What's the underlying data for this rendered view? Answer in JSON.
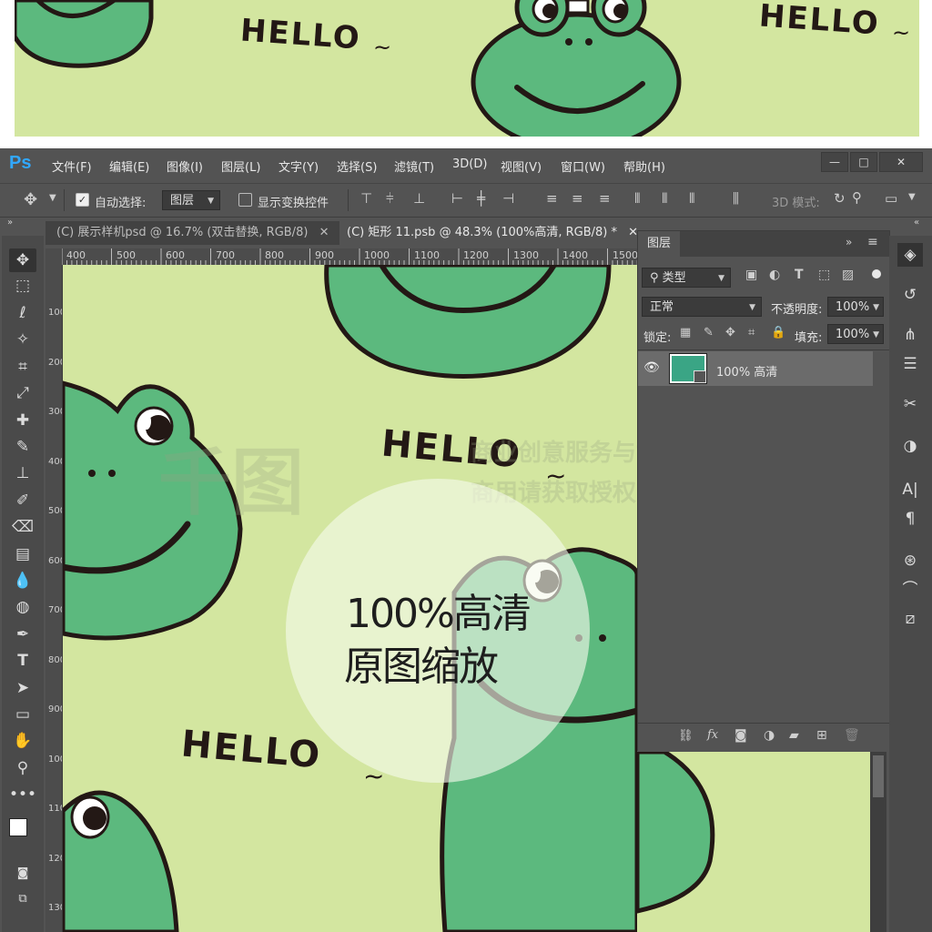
{
  "preview": {
    "hello_left": "HELLO",
    "hello_right": "HELLO"
  },
  "app": {
    "logo": "Ps",
    "menu": [
      "文件(F)",
      "编辑(E)",
      "图像(I)",
      "图层(L)",
      "文字(Y)",
      "选择(S)",
      "滤镜(T)",
      "3D(D)",
      "视图(V)",
      "窗口(W)",
      "帮助(H)"
    ],
    "window_controls": [
      "—",
      "□",
      "✕"
    ]
  },
  "options_bar": {
    "auto_select_label": "自动选择:",
    "auto_select_checked": true,
    "auto_select_value": "图层",
    "show_transform_label": "显示变换控件",
    "show_transform_checked": false,
    "mode_label": "3D 模式:"
  },
  "tabs": [
    {
      "label": "(C) 展示样机psd @ 16.7% (双击替换, RGB/8)",
      "close": "✕",
      "active": false
    },
    {
      "label": "(C) 矩形 11.psb @ 48.3% (100%高清, RGB/8) *",
      "close": "✕",
      "active": true
    }
  ],
  "ruler": {
    "h_ticks": [
      "400",
      "500",
      "600",
      "700",
      "800",
      "900",
      "1000",
      "1100",
      "1200",
      "1300",
      "1400",
      "1500"
    ],
    "v_ticks": [
      "100",
      "200",
      "300",
      "400",
      "500",
      "600",
      "700",
      "800",
      "900",
      "1000",
      "1100",
      "1200",
      "1300"
    ]
  },
  "canvas": {
    "hello_1": "HELLO",
    "hello_2": "HELLO"
  },
  "overlay": {
    "line1": "100%高清",
    "line2": "原图缩放"
  },
  "watermark": {
    "brand": "千图",
    "line1": "商业创意服务与协作平台",
    "line2": "商用请获取授权"
  },
  "layers_panel": {
    "title": "图层",
    "filter_label": "类型",
    "blend_mode": "正常",
    "opacity_label": "不透明度:",
    "opacity_value": "100%",
    "lock_label": "锁定:",
    "fill_label": "填充:",
    "fill_value": "100%",
    "layers": [
      {
        "name": "100% 高清",
        "visible": true,
        "thumb_color": "#3aa585"
      }
    ],
    "footer_icons": [
      "link-icon",
      "fx-icon",
      "mask-icon",
      "adjustment-icon",
      "folder-icon",
      "new-layer-icon",
      "trash-icon"
    ],
    "fx_label": "fx"
  },
  "colors": {
    "bg_green": "#d3e6a0",
    "frog_green": "#5cb97e",
    "ui_dark": "#535353"
  }
}
